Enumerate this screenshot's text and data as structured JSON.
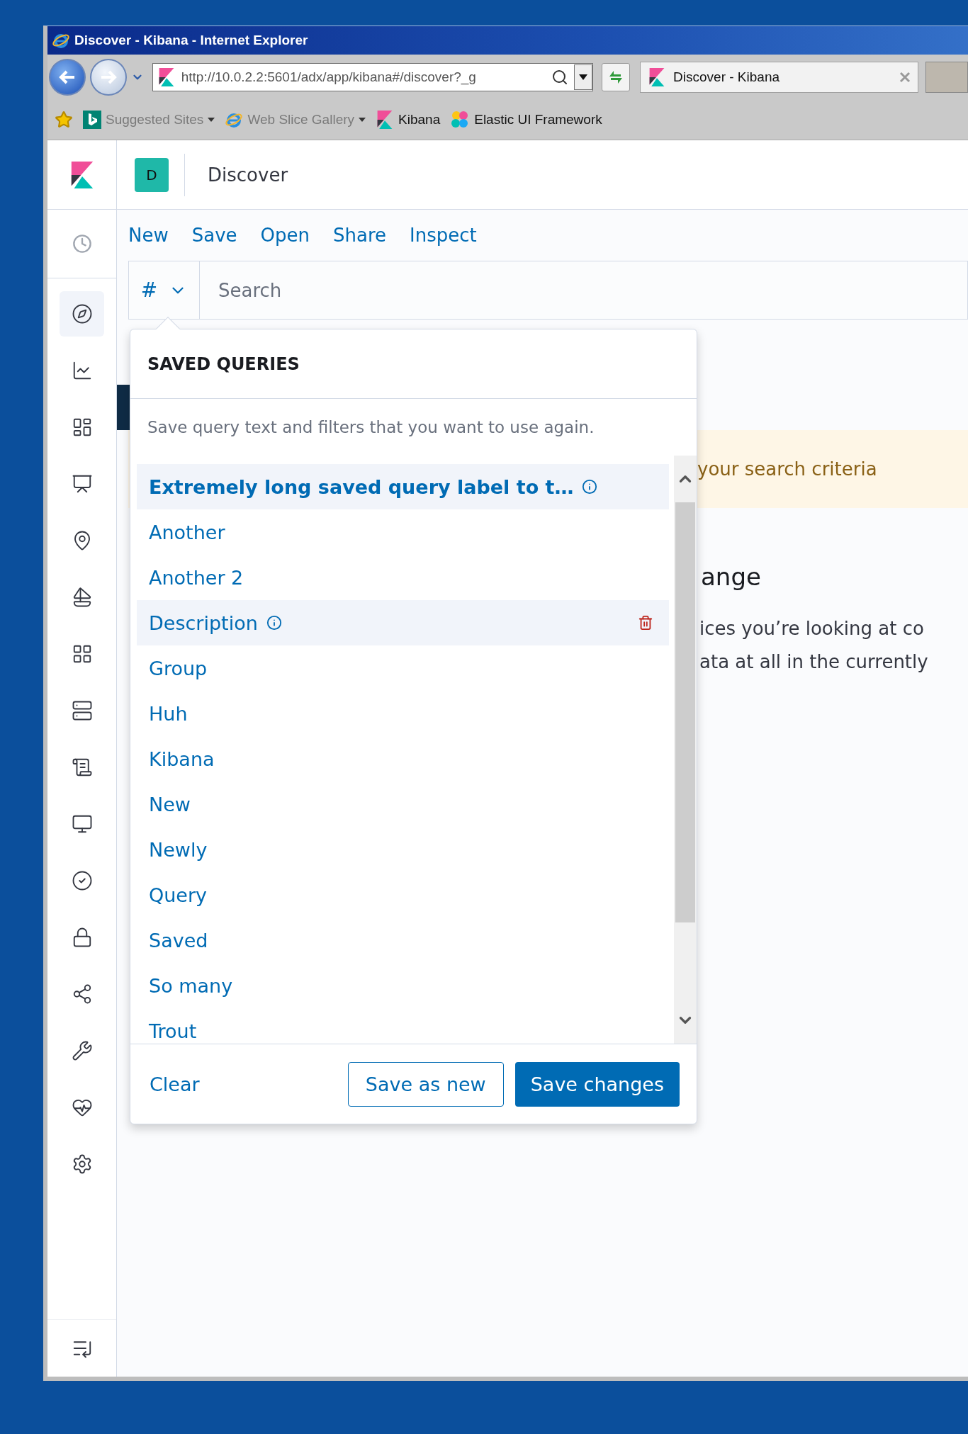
{
  "browser": {
    "title": "Discover - Kibana - Internet Explorer",
    "address": "http://10.0.2.2:5601/adx/app/kibana#/discover?_g",
    "tabs": [
      {
        "label": "Discover - Kibana",
        "selected": true
      }
    ],
    "favorites": [
      {
        "label": "Suggested Sites",
        "kind": "bing",
        "menu": true,
        "disabled": true
      },
      {
        "label": "Web Slice Gallery",
        "kind": "ie",
        "menu": true,
        "disabled": true
      },
      {
        "label": "Kibana",
        "kind": "kibana",
        "menu": false,
        "disabled": false
      },
      {
        "label": "Elastic UI Framework",
        "kind": "elastic",
        "menu": false,
        "disabled": false
      }
    ]
  },
  "header": {
    "space": "D",
    "breadcrumb": "Discover"
  },
  "nav": [
    {
      "kind": "discover",
      "selected": true
    },
    {
      "kind": "visualize",
      "selected": false
    },
    {
      "kind": "dashboard",
      "selected": false
    },
    {
      "kind": "canvas",
      "selected": false
    },
    {
      "kind": "maps",
      "selected": false
    },
    {
      "kind": "apm",
      "selected": false
    },
    {
      "kind": "ml",
      "selected": false
    },
    {
      "kind": "infra",
      "selected": false
    },
    {
      "kind": "logs",
      "selected": false
    },
    {
      "kind": "uptime",
      "selected": false
    },
    {
      "kind": "siem",
      "selected": false
    },
    {
      "kind": "security",
      "selected": false
    },
    {
      "kind": "graph",
      "selected": false
    },
    {
      "kind": "devtools",
      "selected": false
    },
    {
      "kind": "monitoring",
      "selected": false
    },
    {
      "kind": "management",
      "selected": false
    }
  ],
  "top_menu": [
    "New",
    "Save",
    "Open",
    "Share",
    "Inspect"
  ],
  "query_bar": {
    "language": "#",
    "placeholder": "Search"
  },
  "saved_queries": {
    "title": "SAVED QUERIES",
    "description": "Save query text and filters that you want to use again.",
    "items": [
      {
        "label": "Extremely long saved query label to t…",
        "selected": true,
        "hovered": false,
        "info": true
      },
      {
        "label": "Another",
        "selected": false,
        "hovered": false,
        "info": false
      },
      {
        "label": "Another 2",
        "selected": false,
        "hovered": false,
        "info": false
      },
      {
        "label": "Description",
        "selected": false,
        "hovered": true,
        "info": true
      },
      {
        "label": "Group",
        "selected": false,
        "hovered": false,
        "info": false
      },
      {
        "label": "Huh",
        "selected": false,
        "hovered": false,
        "info": false
      },
      {
        "label": "Kibana",
        "selected": false,
        "hovered": false,
        "info": false
      },
      {
        "label": "New",
        "selected": false,
        "hovered": false,
        "info": false
      },
      {
        "label": "Newly",
        "selected": false,
        "hovered": false,
        "info": false
      },
      {
        "label": "Query",
        "selected": false,
        "hovered": false,
        "info": false
      },
      {
        "label": "Saved",
        "selected": false,
        "hovered": false,
        "info": false
      },
      {
        "label": "So many",
        "selected": false,
        "hovered": false,
        "info": false
      },
      {
        "label": "Trout",
        "selected": false,
        "hovered": false,
        "info": false
      }
    ],
    "footer": {
      "clear": "Clear",
      "save_as_new": "Save as new",
      "save_changes": "Save changes"
    }
  },
  "background": {
    "callout": "your search criteria",
    "heading": "ange",
    "lines": [
      "ices you’re looking at co",
      "ata at all in the currently"
    ]
  }
}
